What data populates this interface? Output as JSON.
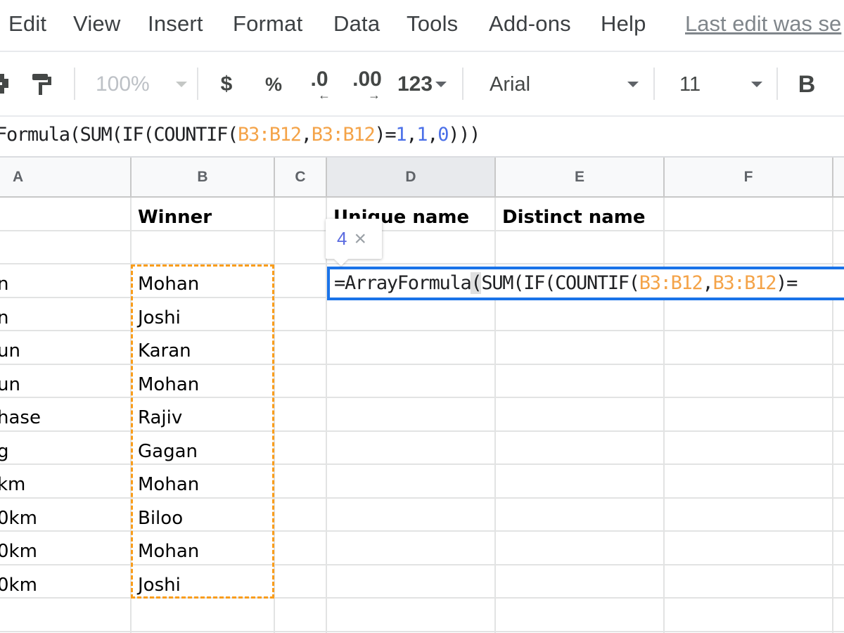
{
  "menu": {
    "items": [
      "Edit",
      "View",
      "Insert",
      "Format",
      "Data",
      "Tools",
      "Add-ons",
      "Help"
    ],
    "last_edit": "Last edit was se"
  },
  "toolbar": {
    "print_icon": "print-icon",
    "paint_format_icon": "paint-format-icon",
    "zoom": "100%",
    "currency": "$",
    "percent": "%",
    "decrease_decimal": ".0",
    "increase_decimal": ".00",
    "more_formats": "123",
    "font": "Arial",
    "font_size": "11",
    "bold": "B"
  },
  "formula_bar": {
    "segments": [
      {
        "text": "Formula(SUM(IF(COUNTIF(",
        "type": "plain"
      },
      {
        "text": "B3:B12",
        "type": "ref"
      },
      {
        "text": ",",
        "type": "plain"
      },
      {
        "text": "B3:B12",
        "type": "ref"
      },
      {
        "text": ")=",
        "type": "plain"
      },
      {
        "text": "1",
        "type": "num"
      },
      {
        "text": ",",
        "type": "plain"
      },
      {
        "text": "1",
        "type": "num"
      },
      {
        "text": ",",
        "type": "plain"
      },
      {
        "text": "0",
        "type": "num"
      },
      {
        "text": ")))",
        "type": "plain"
      }
    ]
  },
  "grid": {
    "columns": [
      "A",
      "B",
      "C",
      "D",
      "E",
      "F"
    ],
    "active_column": "D",
    "header_row": {
      "B": "Winner",
      "D": "Unique name",
      "E": "Distinct name"
    },
    "column_a_partial": [
      "n",
      "n",
      "un",
      "un",
      "hase",
      "g",
      "km",
      "0km",
      "0km",
      "0km"
    ],
    "winners": [
      "Mohan",
      "Joshi",
      "Karan",
      "Mohan",
      "Rajiv",
      "Gagan",
      "Mohan",
      "Biloo",
      "Mohan",
      "Joshi"
    ]
  },
  "editor": {
    "segments": [
      {
        "text": "=ArrayFormula",
        "type": "plain"
      },
      {
        "text": "(",
        "type": "hl"
      },
      {
        "text": "SUM(IF(COUNTIF(",
        "type": "plain"
      },
      {
        "text": "B3:B12",
        "type": "ref"
      },
      {
        "text": ",",
        "type": "plain"
      },
      {
        "text": "B3:B12",
        "type": "ref"
      },
      {
        "text": ")=",
        "type": "plain"
      }
    ]
  },
  "tooltip": {
    "value": "4",
    "close": "×"
  },
  "colors": {
    "selection_blue": "#1a73e8",
    "copy_marquee_orange": "#f99d1c",
    "range_ref_orange": "#f4a348",
    "number_blue": "#4a6fe8"
  }
}
